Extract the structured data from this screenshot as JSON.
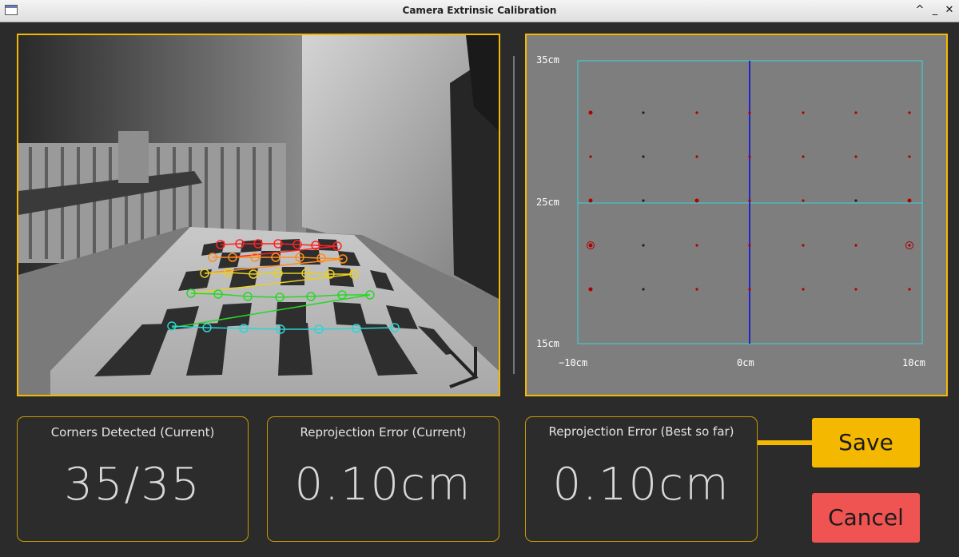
{
  "window": {
    "title": "Camera Extrinsic Calibration",
    "controls": {
      "maximize": "^",
      "minimize": "_",
      "close": "✕"
    }
  },
  "plot": {
    "y_labels": [
      "35cm",
      "25cm",
      "15cm"
    ],
    "x_labels": [
      "−10cm",
      "0cm",
      "10cm"
    ]
  },
  "metrics": {
    "corners": {
      "label": "Corners Detected (Current)",
      "value": "35/35"
    },
    "reproj_current": {
      "label": "Reprojection Error (Current)",
      "value": "0.10cm"
    },
    "reproj_best": {
      "label": "Reprojection Error (Best so far)",
      "value": "0.10cm"
    }
  },
  "buttons": {
    "save": "Save",
    "cancel": "Cancel"
  },
  "colors": {
    "accent": "#f5b800",
    "cancel": "#f05452",
    "plot_grid": "#38d6dc",
    "plot_center_axis": "#2222cc",
    "point_red": "#b00000",
    "point_dark": "#202020",
    "rows": [
      "#ff2020",
      "#ff8c1a",
      "#e8d020",
      "#2ad62a",
      "#2ad6d6"
    ]
  }
}
